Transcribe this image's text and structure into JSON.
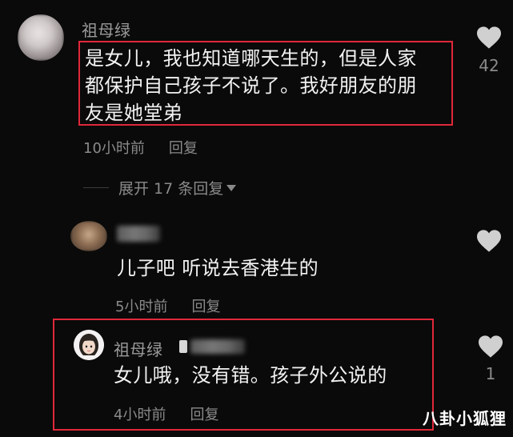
{
  "comments": [
    {
      "username": "祖母绿",
      "text_lines": [
        "是女儿，我也知道哪天生的，但是人家",
        "都保护自己孩子不说了。我好朋友的朋",
        "友是她堂弟"
      ],
      "time": "10小时前",
      "reply_label": "回复",
      "likes": "42"
    }
  ],
  "expand": {
    "label": "展开 17 条回复"
  },
  "replies": [
    {
      "text": "儿子吧 听说去香港生的",
      "time": "5小时前",
      "reply_label": "回复"
    },
    {
      "username": "祖母绿",
      "text": "女儿哦，没有错。孩子外公说的",
      "time": "4小时前",
      "reply_label": "回复",
      "likes": "1"
    }
  ],
  "watermark": "八卦小狐狸",
  "colors": {
    "background": "#0a0a0a",
    "highlight_box": "#e0283a",
    "muted_text": "#8a8a8a"
  },
  "icons": {
    "like": "heart-icon",
    "expand": "triangle-down-icon"
  }
}
